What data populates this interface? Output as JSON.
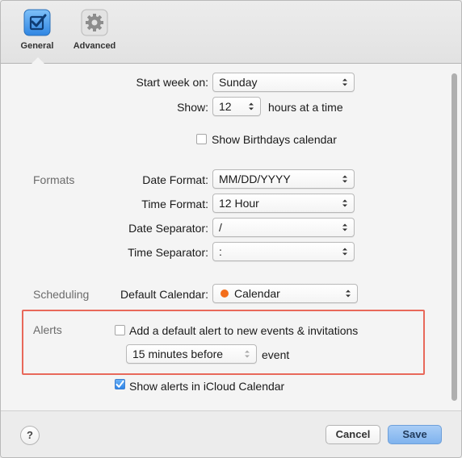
{
  "toolbar": {
    "tabs": [
      {
        "label": "General",
        "icon": "checkbox-icon",
        "selected": true
      },
      {
        "label": "Advanced",
        "icon": "gear-icon",
        "selected": false
      }
    ]
  },
  "general": {
    "start_week_label": "Start week on:",
    "start_week_value": "Sunday",
    "show_label": "Show:",
    "show_value": "12",
    "show_suffix": "hours at a time",
    "birthdays_label": "Show Birthdays calendar",
    "birthdays_checked": false
  },
  "formats": {
    "section_label": "Formats",
    "date_format_label": "Date Format:",
    "date_format_value": "MM/DD/YYYY",
    "time_format_label": "Time Format:",
    "time_format_value": "12 Hour",
    "date_separator_label": "Date Separator:",
    "date_separator_value": "/",
    "time_separator_label": "Time Separator:",
    "time_separator_value": ":"
  },
  "scheduling": {
    "section_label": "Scheduling",
    "default_calendar_label": "Default Calendar:",
    "default_calendar_value": "Calendar",
    "calendar_color": "#f36d1a"
  },
  "alerts": {
    "section_label": "Alerts",
    "default_alert_label": "Add a default alert to new events & invitations",
    "default_alert_checked": false,
    "alert_time_value": "15 minutes before",
    "alert_time_suffix": "event",
    "icloud_alerts_label": "Show alerts in iCloud Calendar",
    "icloud_alerts_checked": true
  },
  "footer": {
    "help_label": "?",
    "cancel_label": "Cancel",
    "save_label": "Save"
  },
  "colors": {
    "accent": "#2c84e8",
    "highlight_border": "#e8685a"
  }
}
